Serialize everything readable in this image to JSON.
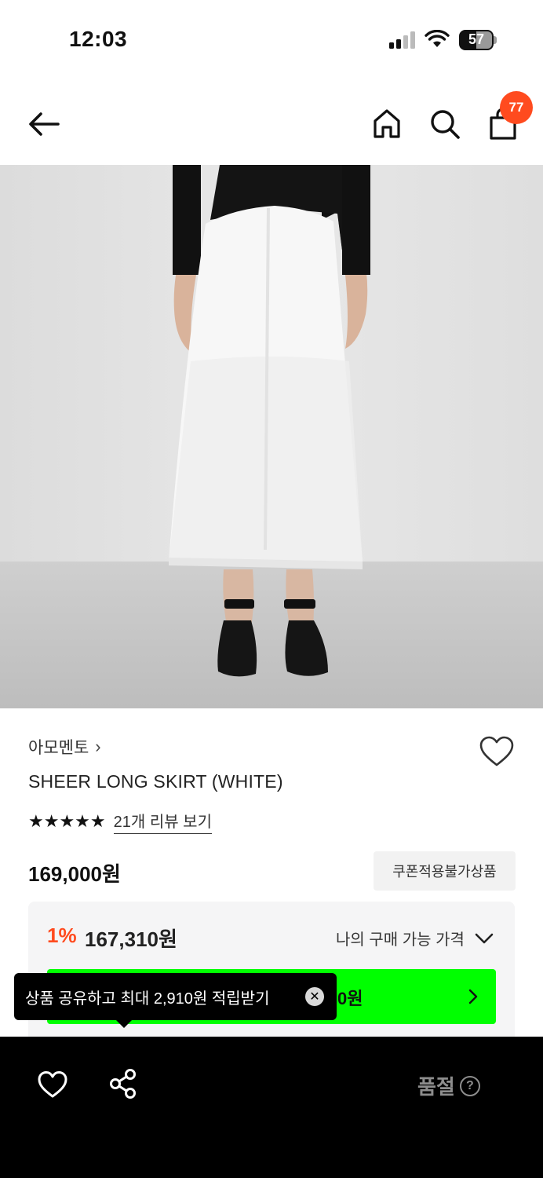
{
  "status_bar": {
    "time": "12:03",
    "battery": "57"
  },
  "header": {
    "back_icon": "arrow-left-icon",
    "home_icon": "home-icon",
    "search_icon": "search-icon",
    "bag_icon": "shopping-bag-icon",
    "bag_count": "77",
    "badge_color": "#ff4b1f"
  },
  "product": {
    "brand": "아모멘토",
    "brand_chevron": "›",
    "name": "SHEER LONG SKIRT (WHITE)",
    "rating_stars": 5,
    "stars_text": "★★★★★",
    "review_link": "21개 리뷰 보기",
    "price": "169,000원",
    "coupon_note": "쿠폰적용불가상품"
  },
  "price_box": {
    "discount": "1%",
    "final_price": "167,310원",
    "my_price_label": "나의 구매 가능 가격",
    "button_text_visible": "0원",
    "button_color": "#00ff00",
    "discount_color": "#ff4b1f"
  },
  "tooltip": {
    "text": "상품 공유하고 최대 2,910원 적립받기",
    "close_symbol": "✕"
  },
  "bottom_bar": {
    "soldout_label": "품절",
    "help_symbol": "?"
  }
}
